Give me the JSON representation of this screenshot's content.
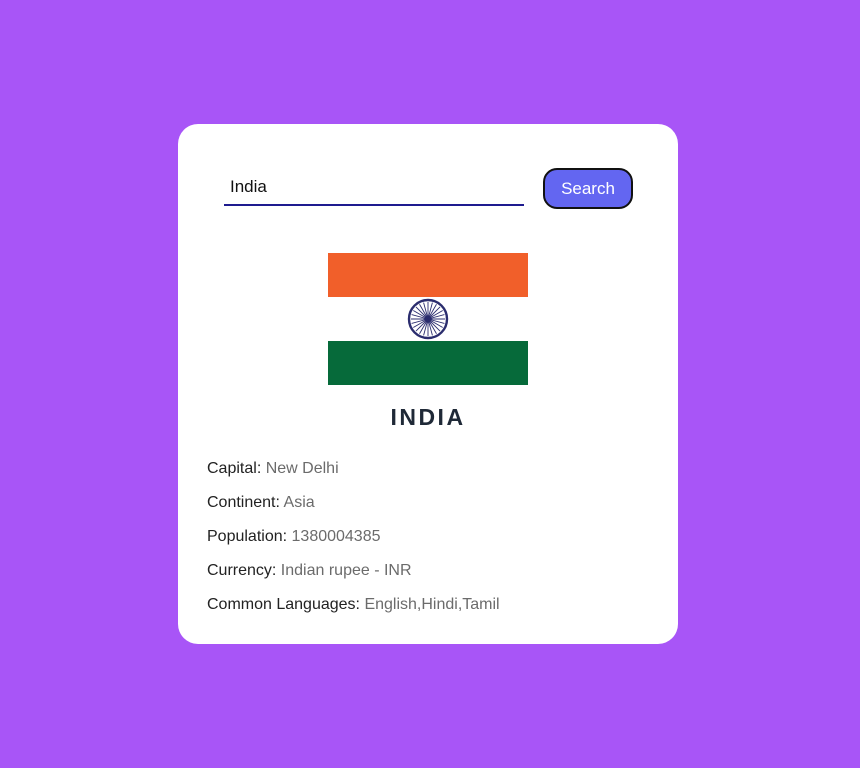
{
  "search": {
    "value": "India",
    "button_label": "Search"
  },
  "country": {
    "name": "INDIA",
    "flag_colors": {
      "saffron": "#f15f2a",
      "white": "#ffffff",
      "green": "#066a3a",
      "chakra": "#2b2d6e"
    },
    "details": [
      {
        "label": "Capital",
        "value": "New Delhi"
      },
      {
        "label": "Continent",
        "value": "Asia"
      },
      {
        "label": "Population",
        "value": "1380004385"
      },
      {
        "label": "Currency",
        "value": "Indian rupee - INR"
      },
      {
        "label": "Common Languages",
        "value": "English,Hindi,Tamil"
      }
    ]
  },
  "theme": {
    "background": "#a855f7",
    "button": "#6366f1"
  }
}
